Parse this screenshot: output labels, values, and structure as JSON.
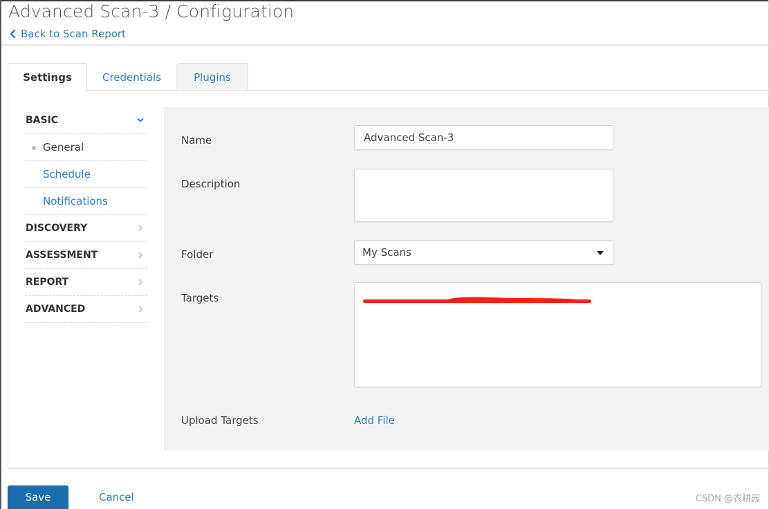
{
  "header": {
    "title": "Advanced Scan-3 / Configuration",
    "back_link": "Back to Scan Report"
  },
  "tabs": [
    {
      "label": "Settings",
      "active": true
    },
    {
      "label": "Credentials",
      "active": false
    },
    {
      "label": "Plugins",
      "active": false
    }
  ],
  "sidebar": {
    "sections": [
      {
        "label": "BASIC",
        "expanded": true,
        "items": [
          {
            "label": "General",
            "current": true
          },
          {
            "label": "Schedule",
            "current": false
          },
          {
            "label": "Notifications",
            "current": false
          }
        ]
      },
      {
        "label": "DISCOVERY",
        "expanded": false
      },
      {
        "label": "ASSESSMENT",
        "expanded": false
      },
      {
        "label": "REPORT",
        "expanded": false
      },
      {
        "label": "ADVANCED",
        "expanded": false
      }
    ]
  },
  "form": {
    "name": {
      "label": "Name",
      "value": "Advanced Scan-3"
    },
    "description": {
      "label": "Description",
      "value": ""
    },
    "folder": {
      "label": "Folder",
      "selected": "My Scans"
    },
    "targets": {
      "label": "Targets",
      "value": "[redacted]"
    },
    "upload_targets": {
      "label": "Upload Targets",
      "action": "Add File"
    }
  },
  "footer": {
    "save": "Save",
    "cancel": "Cancel"
  },
  "watermark": "CSDN @农耕园",
  "colors": {
    "accent": "#1b6ead",
    "link": "#357ebd",
    "panel_bg": "#f3f3f3",
    "redaction": "#ff1e14"
  }
}
